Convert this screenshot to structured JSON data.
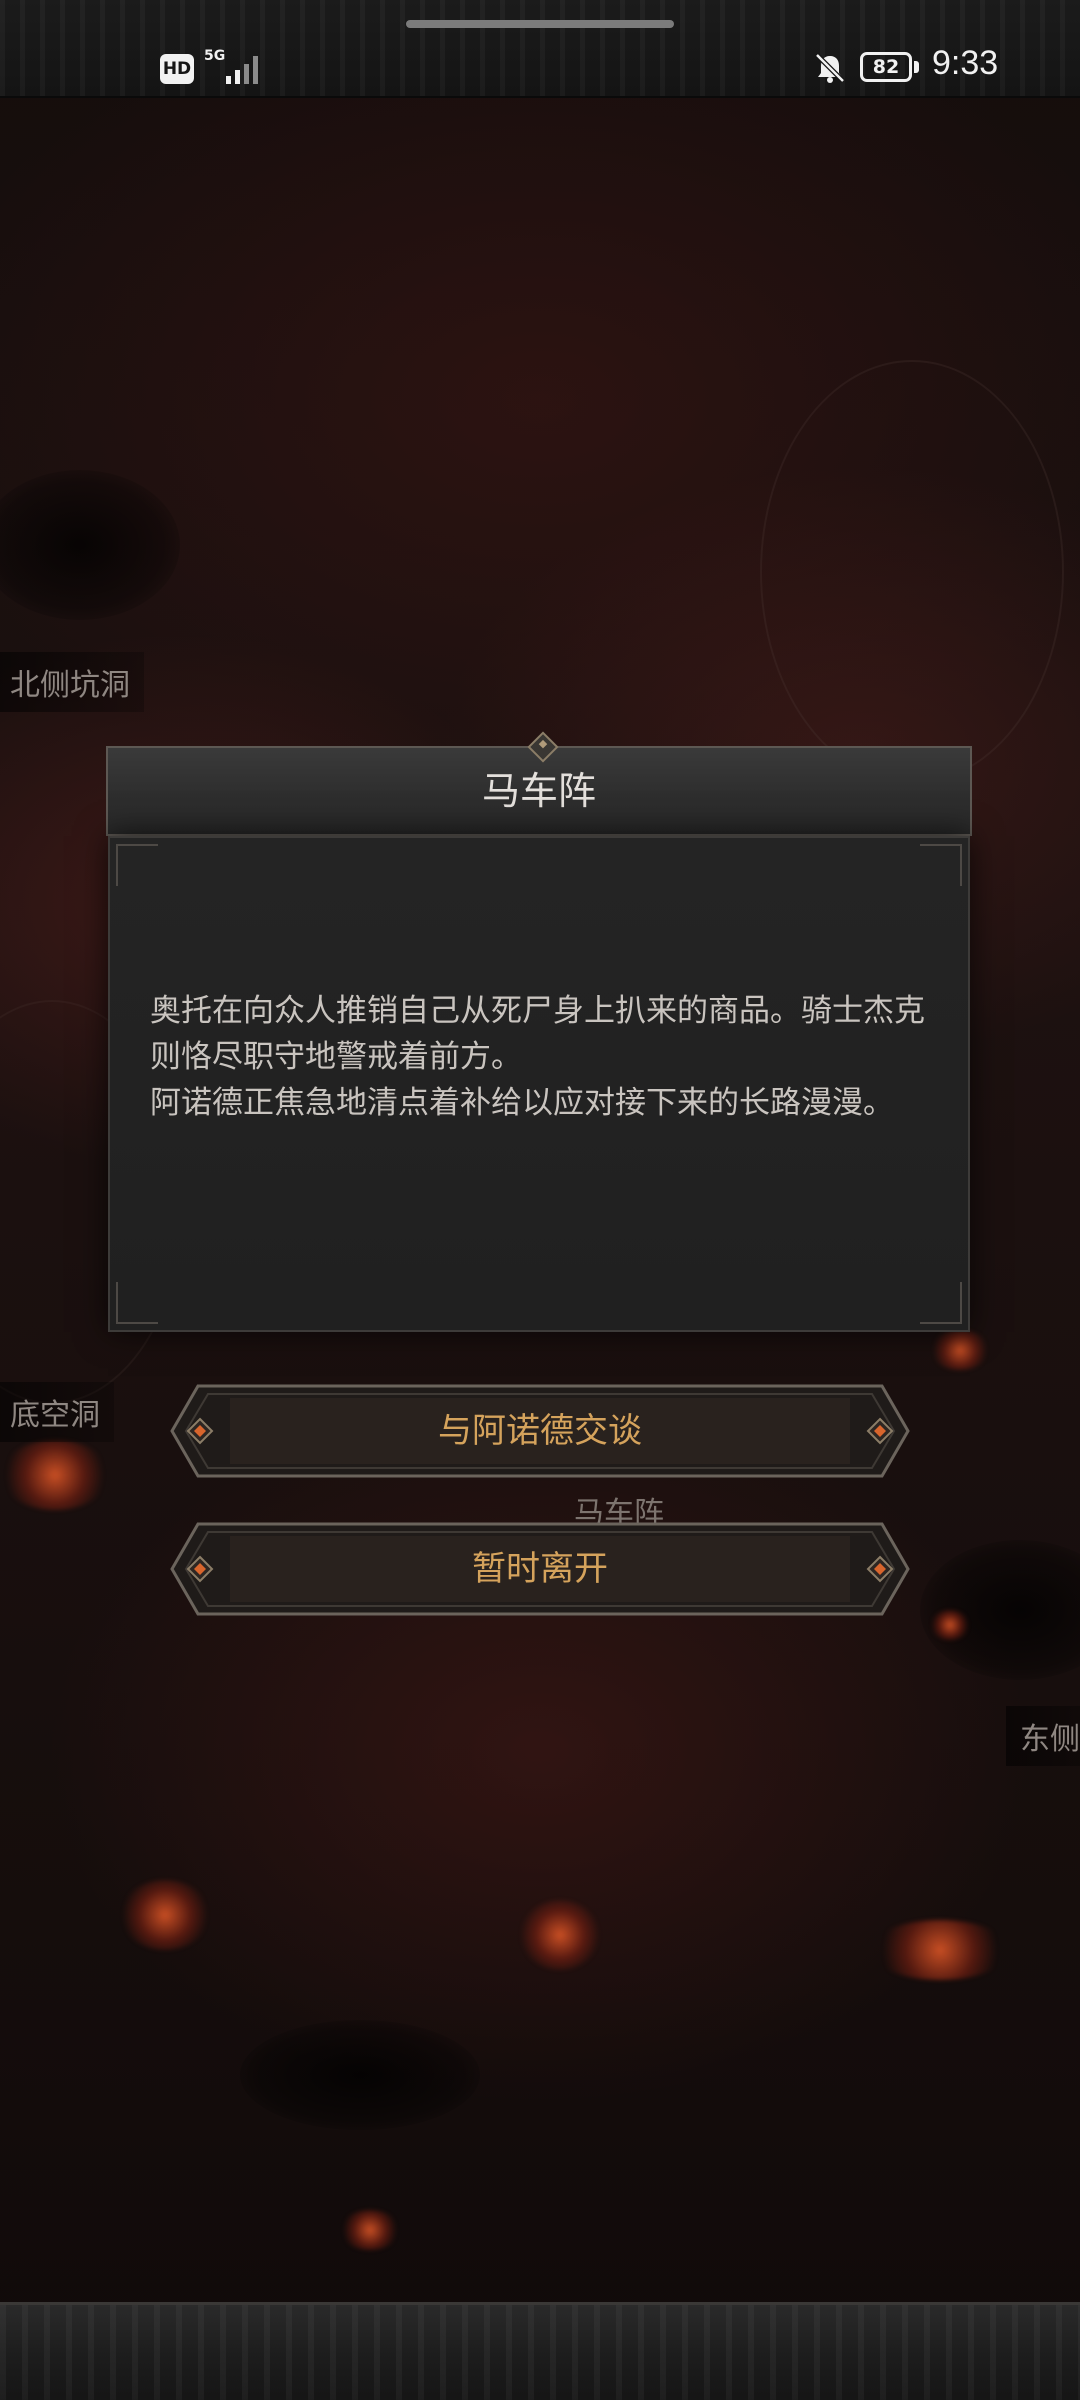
{
  "status_bar": {
    "hd_badge": "HD",
    "network": "5G",
    "battery_level": "82",
    "time": "9:33",
    "icons": [
      "hd-icon",
      "signal-icon",
      "bell-off-icon",
      "battery-icon"
    ]
  },
  "map": {
    "labels": {
      "north_cave": "北侧坑洞",
      "bottom_cave": "底空洞",
      "camp_under": "马车阵",
      "east": "东侧"
    }
  },
  "dialog": {
    "title": "马车阵",
    "paragraph_1": "奥托在向众人推销自己从死尸身上扒来的商品。骑士杰克则恪尽职守地警戒着前方。",
    "paragraph_2": "阿诺德正焦急地清点着补给以应对接下来的长路漫漫。"
  },
  "choices": {
    "talk_label": "与阿诺德交谈",
    "leave_label": "暂时离开"
  },
  "colors": {
    "accent_gold": "#d5a35c",
    "gem_orange": "#d8652c",
    "dialog_bg": "#222222"
  }
}
